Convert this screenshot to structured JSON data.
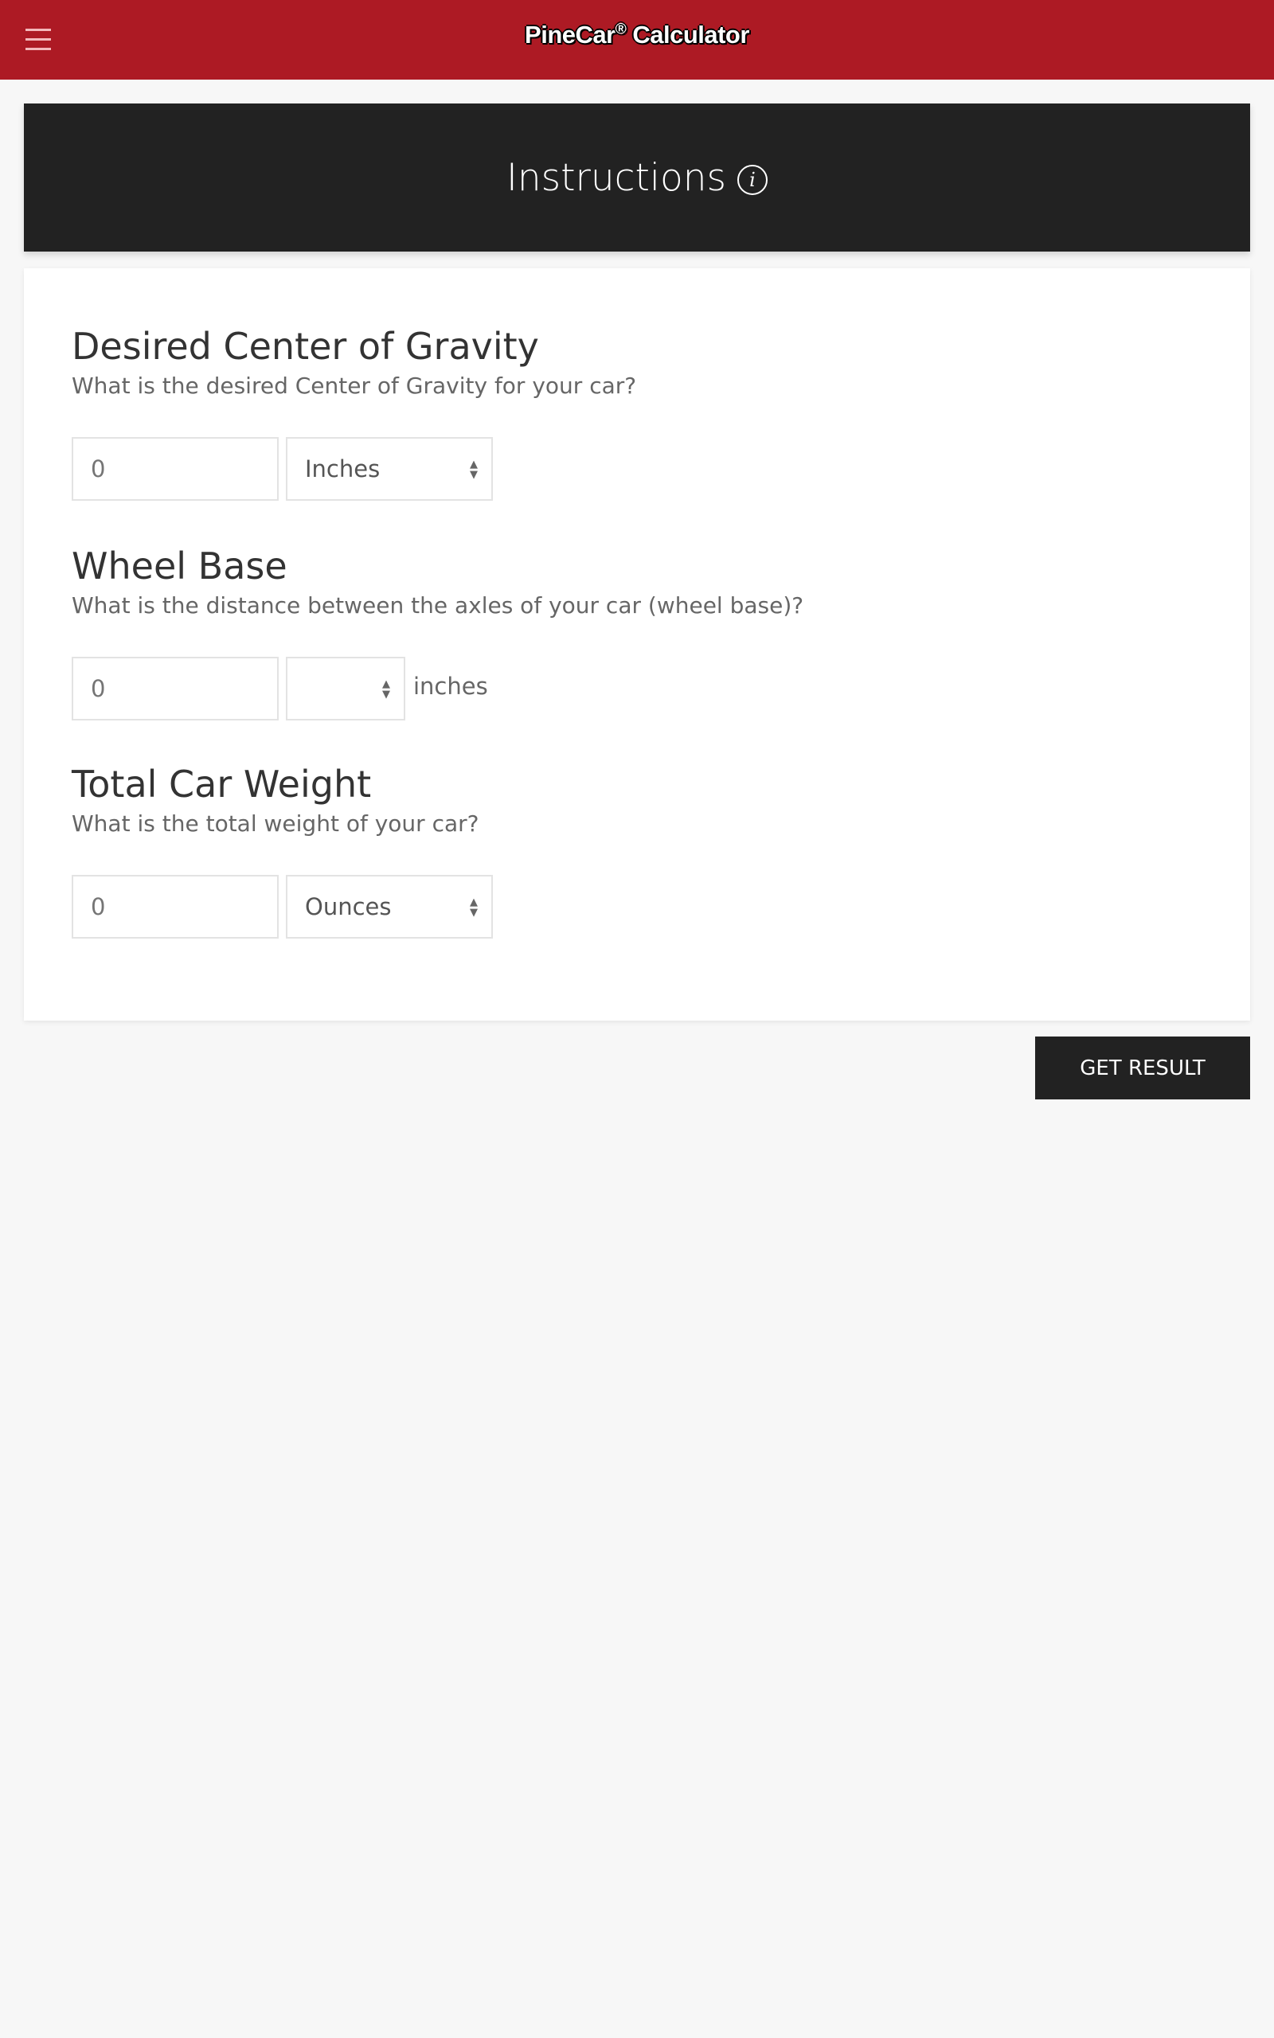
{
  "header": {
    "title": "PineCar",
    "title_mark": "®",
    "title_suffix": " Calculator",
    "menu_icon": "hamburger-icon",
    "color": "#ad1a24"
  },
  "instructions": {
    "label": "Instructions",
    "icon": "info-icon"
  },
  "sections": [
    {
      "title": "Desired Center of Gravity",
      "question": "What is the desired Center of Gravity for your car?",
      "value": "0",
      "unit_select": "Inches"
    },
    {
      "title": "Wheel Base",
      "question": "What is the distance between the axles of your car (wheel base)?",
      "value": "0",
      "unit_select": "",
      "unit_label": "inches"
    },
    {
      "title": "Total Car Weight",
      "question": "What is the total weight of your car?",
      "value": "0",
      "unit_select": "Ounces"
    }
  ],
  "actions": {
    "get_result": "GET RESULT"
  }
}
